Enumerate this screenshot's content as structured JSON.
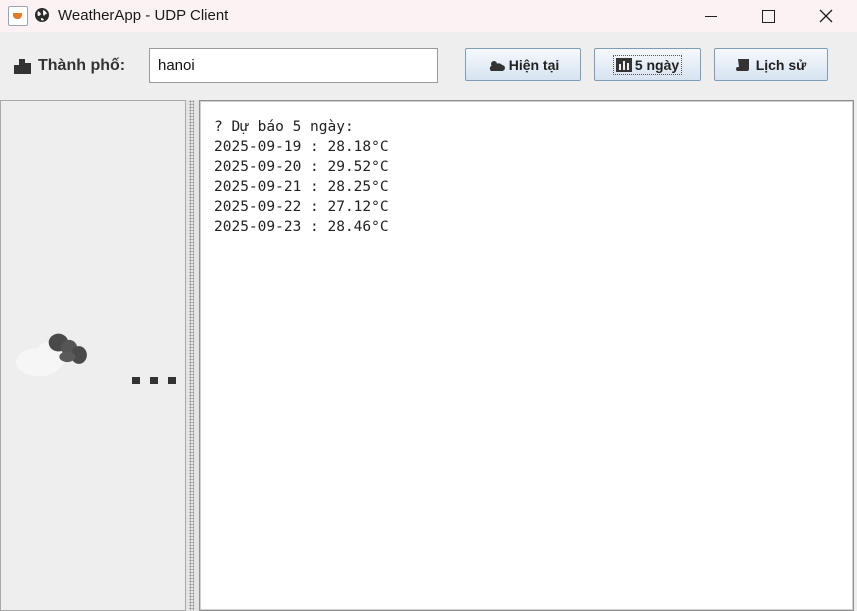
{
  "window": {
    "title": "WeatherApp - UDP Client",
    "app_icon": "java-cup-icon",
    "title_icon": "globe-icon",
    "controls": [
      "minimize",
      "maximize",
      "close"
    ]
  },
  "toolbar": {
    "city_label": "Thành phố:",
    "city_icon": "city-buildings-icon",
    "city_value": "hanoi",
    "buttons": {
      "current": {
        "label": "Hiện tại",
        "icon": "sun-cloud-icon"
      },
      "forecast": {
        "label": "5 ngày",
        "icon": "bar-chart-icon"
      },
      "history": {
        "label": "Lịch sử",
        "icon": "scroll-icon"
      }
    }
  },
  "left_panel": {
    "animation": "cloud-loading-icon"
  },
  "output": {
    "header_glyph": "?",
    "header": "Dự báo 5 ngày:",
    "lines": [
      "2025-09-19 : 28.18°C",
      "2025-09-20 : 29.52°C",
      "2025-09-21 : 28.25°C",
      "2025-09-22 : 27.12°C",
      "2025-09-23 : 28.46°C"
    ]
  },
  "colors": {
    "titlebar_bg": "#fbf3f3",
    "window_bg": "#eeeeee",
    "button_border": "#7f9db9"
  }
}
